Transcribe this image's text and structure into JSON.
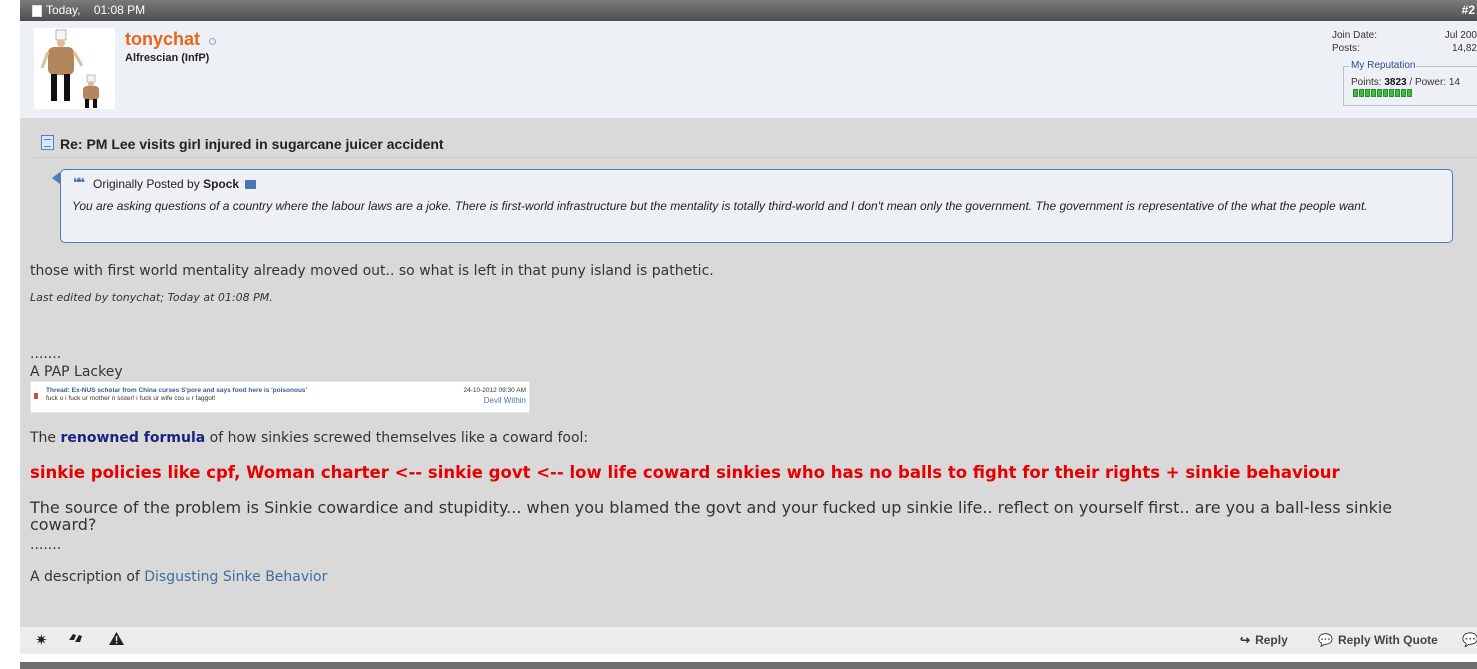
{
  "header": {
    "date": "Today,",
    "time": "01:08 PM",
    "post_number": "#2"
  },
  "user": {
    "name": "tonychat",
    "title": "Alfrescian (InfP)",
    "join_date_label": "Join Date:",
    "join_date": "Jul 200",
    "posts_label": "Posts:",
    "posts": "14,82",
    "reputation": {
      "legend": "My Reputation",
      "points_label": "Points:",
      "points": "3823",
      "power_label": "/ Power: 14",
      "bar_segments": 10
    }
  },
  "post": {
    "title": "Re: PM Lee visits girl injured in sugarcane juicer accident",
    "quote": {
      "prefix": "Originally Posted by",
      "author": "Spock",
      "text": "You are asking questions of a country where the labour laws are a joke. There is first-world infrastructure but the mentality is totally third-world and I don't mean only the government. The government is representative of the what the people want."
    },
    "message": "those with first world mentality already moved out.. so what is left in that puny island is pathetic.",
    "last_edited": "Last edited by tonychat; Today at 01:08 PM."
  },
  "signature": {
    "dots_1": ".......",
    "lackey": "A PAP Lackey",
    "embed": {
      "thread": "Thread: Ex-NUS scholar from China curses S'pore and says food here is 'poisonous'",
      "snippet": "fuck u i fuck ur mother n sister! i fuck ur wife cos u r faggot!",
      "date": "24-10-2012 09:30 AM",
      "user": "Devil Within"
    },
    "formula_prefix": "The",
    "formula_link": "renowned formula",
    "formula_suffix": "of how sinkies screwed themselves like a coward fool:",
    "red_line": "sinkie policies like cpf, Woman charter <-- sinkie govt <-- low life coward sinkies who has no balls to fight for their rights + sinkie behaviour",
    "source": "The source of the problem is Sinkie cowardice and stupidity... when you blamed the govt and your fucked up sinkie life.. reflect on yourself first.. are you a ball-less sinkie coward?",
    "dots_2": ".......",
    "desc_prefix": "A description of",
    "desc_link": "Disgusting Sinke Behavior"
  },
  "footer": {
    "reply": "Reply",
    "reply_with_quote": "Reply With Quote"
  },
  "icons": {
    "header": "document-icon",
    "title": "post-icon",
    "quote": "quote-icon",
    "footer_left": [
      "star-icon",
      "thumbs-icon",
      "warning-icon"
    ]
  }
}
